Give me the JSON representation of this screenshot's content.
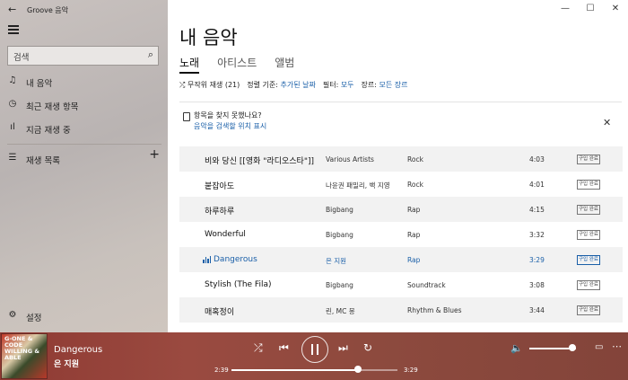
{
  "app": {
    "title": "Groove 음악"
  },
  "search": {
    "placeholder": "검색"
  },
  "nav": {
    "my_music": "내 음악",
    "recent": "최근 재생 항목",
    "now_playing": "지금 재생 중",
    "playlists": "재생 목록",
    "settings": "설정"
  },
  "page": {
    "title": "내 음악",
    "tabs": [
      "노래",
      "아티스트",
      "앨범"
    ]
  },
  "filters": {
    "shuffle": "무작위 재생 (21)",
    "sort_label": "정렬 기준:",
    "sort_value": "추가된 날짜",
    "filter_label": "필터:",
    "filter_value": "모두",
    "genre_label": "장르:",
    "genre_value": "모든 장르"
  },
  "notice": {
    "text": "항목을 찾지 못했나요?",
    "link": "음악을 검색할 위치 표시"
  },
  "songs": [
    {
      "title": "비와 당신 [[영화 \"라디오스타\"]]",
      "artist": "Various Artists",
      "genre": "Rock",
      "duration": "4:03",
      "badge": "구입 완료"
    },
    {
      "title": "붙잡아도",
      "artist": "나윤권 패밀리, 백 지영",
      "genre": "Rock",
      "duration": "4:01",
      "badge": "구입 완료"
    },
    {
      "title": "하루하루",
      "artist": "Bigbang",
      "genre": "Rap",
      "duration": "4:15",
      "badge": "구입 완료"
    },
    {
      "title": "Wonderful",
      "artist": "Bigbang",
      "genre": "Rap",
      "duration": "3:32",
      "badge": "구입 완료"
    },
    {
      "title": "Dangerous",
      "artist": "은 지원",
      "genre": "Rap",
      "duration": "3:29",
      "badge": "구입 완료"
    },
    {
      "title": "Stylish (The Fila)",
      "artist": "Bigbang",
      "genre": "Soundtrack",
      "duration": "3:08",
      "badge": "구입 완료"
    },
    {
      "title": "매혹정이",
      "artist": "린, MC 몽",
      "genre": "Rhythm & Blues",
      "duration": "3:44",
      "badge": "구입 완료"
    }
  ],
  "player": {
    "title": "Dangerous",
    "artist": "은 지원",
    "elapsed": "2:39",
    "total": "3:29",
    "progress": 0.76,
    "volume": 0.92,
    "album_art_text": "G-ONE & CODE WILLING & ABLE"
  },
  "colors": {
    "accent": "#1a5fa8",
    "player_bg": "#8f3a33",
    "sidebar_bg": "#c1bbb8"
  }
}
